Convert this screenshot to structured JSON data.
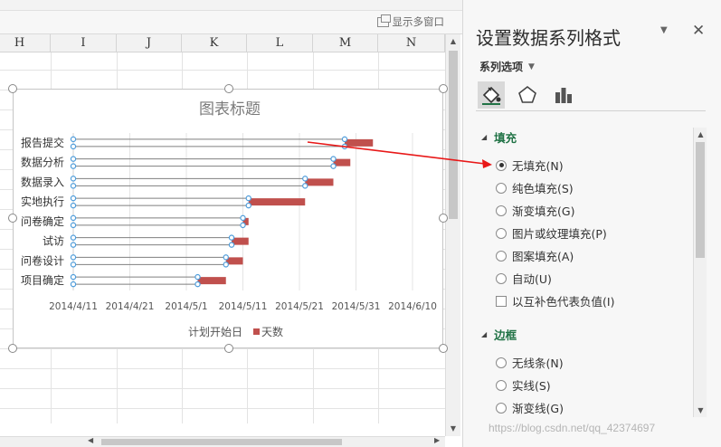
{
  "toolbar": {
    "multi_window_label": "显示多窗口"
  },
  "columns": [
    "H",
    "I",
    "J",
    "K",
    "L",
    "M",
    "N"
  ],
  "chart": {
    "title": "图表标题",
    "legend": [
      {
        "label": "计划开始日",
        "color": "none"
      },
      {
        "label": "天数",
        "color": "#c0504d"
      }
    ]
  },
  "chart_data": {
    "type": "bar",
    "orientation": "horizontal",
    "stacked": true,
    "title": "图表标题",
    "categories": [
      "报告提交",
      "数据分析",
      "数据录入",
      "实地执行",
      "问卷确定",
      "试访",
      "问卷设计",
      "项目确定"
    ],
    "x_tick_labels": [
      "2014/4/11",
      "2014/4/21",
      "2014/5/1",
      "2014/5/11",
      "2014/5/21",
      "2014/5/31",
      "2014/6/10"
    ],
    "xlim": [
      "2014/4/11",
      "2014/6/14"
    ],
    "series": [
      {
        "name": "计划开始日",
        "fill": "none",
        "values": [
          "2014/5/29",
          "2014/5/27",
          "2014/5/22",
          "2014/5/12",
          "2014/5/11",
          "2014/5/9",
          "2014/5/8",
          "2014/5/3"
        ]
      },
      {
        "name": "天数",
        "color": "#c0504d",
        "values": [
          5,
          3,
          5,
          10,
          1,
          3,
          3,
          5
        ]
      }
    ],
    "legend_position": "bottom",
    "grid": true
  },
  "pane": {
    "title": "设置数据系列格式",
    "series_options_label": "系列选项",
    "tabs": [
      {
        "name": "fill-line",
        "icon": "paint-bucket-icon"
      },
      {
        "name": "effects",
        "icon": "pentagon-icon"
      },
      {
        "name": "series-options",
        "icon": "bar-chart-icon"
      }
    ],
    "fill_section": "填充",
    "fill_options": [
      "无填充(N)",
      "纯色填充(S)",
      "渐变填充(G)",
      "图片或纹理填充(P)",
      "图案填充(A)",
      "自动(U)"
    ],
    "fill_selected": 0,
    "invert_label": "以互补色代表负值(I)",
    "border_section": "边框",
    "border_options": [
      "无线条(N)",
      "实线(S)",
      "渐变线(G)"
    ]
  },
  "watermark": "https://blog.csdn.net/qq_42374697",
  "colors": {
    "accent": "#217346",
    "bar": "#c0504d",
    "marker": "#4f9ddb",
    "arrow": "#e81818"
  }
}
